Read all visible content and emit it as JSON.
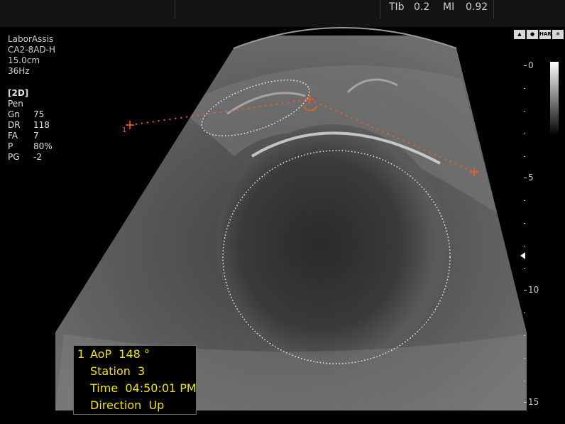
{
  "header": {
    "tib_label": "TIb",
    "tib_value": "0.2",
    "mi_label": "MI",
    "mi_value": "0.92"
  },
  "info": {
    "institution": "LaborAssis",
    "probe": "CA2-8AD-H",
    "depth": "15.0cm",
    "frame_rate": "36Hz"
  },
  "mode": {
    "name": "[2D]",
    "preset": "Pen",
    "params": [
      {
        "key": "Gn",
        "value": "75"
      },
      {
        "key": "DR",
        "value": "118"
      },
      {
        "key": "FA",
        "value": "7"
      },
      {
        "key": "P",
        "value": "80%"
      },
      {
        "key": "PG",
        "value": "-2"
      }
    ]
  },
  "depth_scale": {
    "labels": [
      "0",
      "5",
      "10",
      "15"
    ]
  },
  "measurement": {
    "marker": "1"
  },
  "annotation": {
    "index": "1",
    "aop": "AoP  148 °",
    "station": "Station  3",
    "time": "Time  04:50:01 PM",
    "direction": "Direction  Up"
  },
  "icons": [
    "probe-icon",
    "fetal-icon",
    "har-icon",
    "snowflake-icon"
  ],
  "colors": {
    "annotation": "#f2e400",
    "caliper": "#ff5a1f"
  }
}
